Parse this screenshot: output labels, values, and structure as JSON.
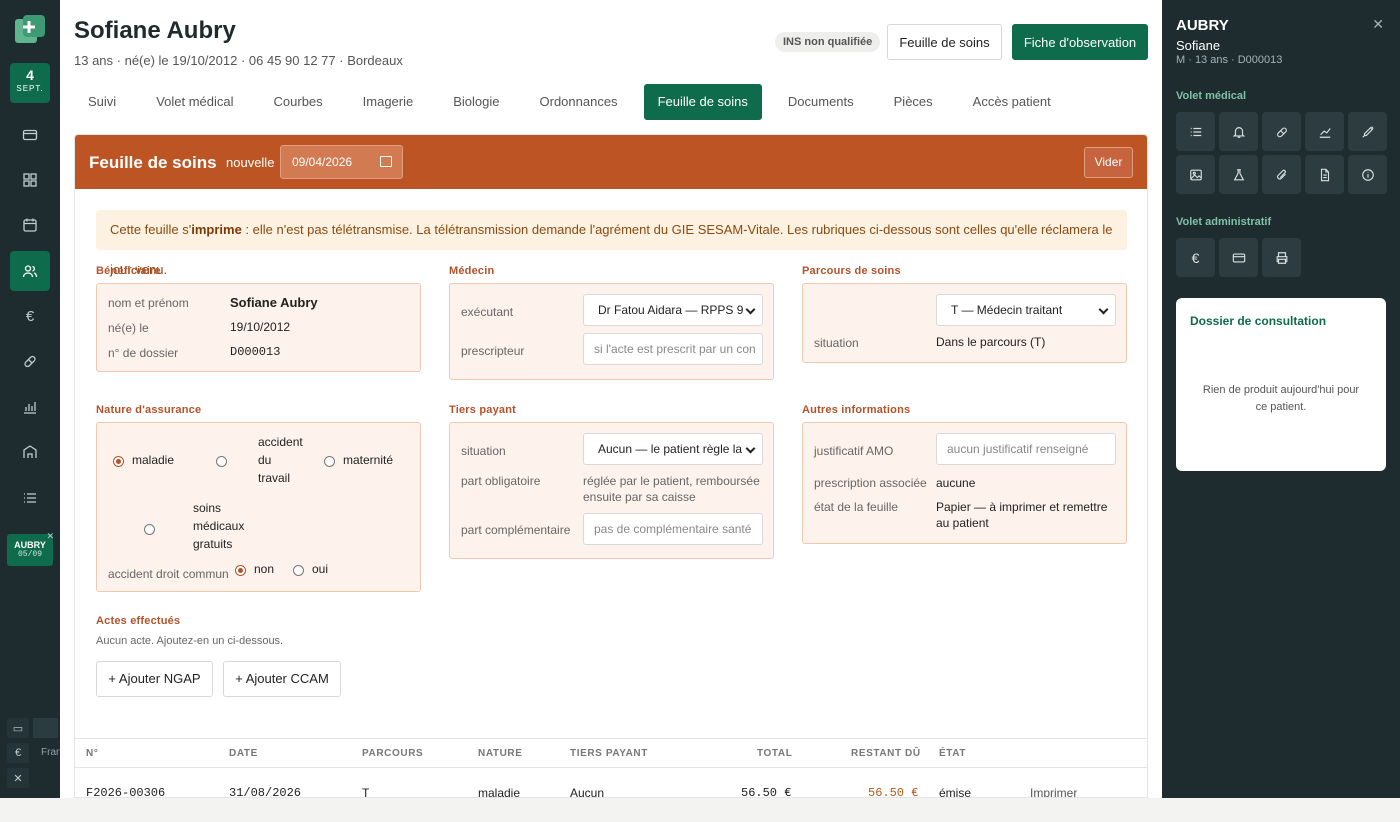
{
  "rail": {
    "date_day": "4",
    "date_month": "SEPT.",
    "chip_name": "AUBRY",
    "chip_date": "05/09",
    "lang_label": "Fran"
  },
  "patient": {
    "name": "Sofiane Aubry",
    "subtitle": "13 ans · né(e) le 19/10/2012 · 06 45 90 12 77 · Bordeaux",
    "ins_badge": "INS non qualifiée"
  },
  "header_buttons": {
    "feuille": "Feuille de soins",
    "fiche": "Fiche d'observation"
  },
  "tabs": [
    {
      "label": "Suivi"
    },
    {
      "label": "Volet médical"
    },
    {
      "label": "Courbes"
    },
    {
      "label": "Imagerie"
    },
    {
      "label": "Biologie"
    },
    {
      "label": "Ordonnances"
    },
    {
      "label": "Feuille de soins"
    },
    {
      "label": "Documents"
    },
    {
      "label": "Pièces"
    },
    {
      "label": "Accès patient"
    }
  ],
  "fs": {
    "title": "Feuille de soins",
    "new_label": "nouvelle",
    "date_value": "09/04/2026",
    "clear_label": "Vider",
    "notice_prefix": "Cette feuille s'",
    "notice_bold": "imprime",
    "notice_suffix": " : elle n'est pas télétransmise. La télétransmission demande l'agrément du GIE SESAM-Vitale. Les rubriques ci-dessous sont celles qu'elle réclamera le jour venu."
  },
  "beneficiaire": {
    "heading": "Bénéficiaire",
    "name_label": "nom et prénom",
    "name_value": "Sofiane Aubry",
    "birth_label": "né(e) le",
    "birth_value": "19/10/2012",
    "file_label": "n° de dossier",
    "file_value": "D000013"
  },
  "medecin": {
    "heading": "Médecin",
    "exec_label": "exécutant",
    "exec_value": "Dr Fatou Aidara — RPPS 9",
    "presc_label": "prescripteur",
    "presc_placeholder": "si l'acte est prescrit par un con"
  },
  "parcours": {
    "heading": "Parcours de soins",
    "select_value": "T — Médecin traitant",
    "situation_label": "situation",
    "situation_value": "Dans le parcours (T)"
  },
  "assurance": {
    "heading": "Nature d'assurance",
    "options": [
      {
        "label": "maladie",
        "checked": true
      },
      {
        "label": "accident du travail",
        "checked": false
      },
      {
        "label": "maternité",
        "checked": false
      },
      {
        "label": "soins médicaux gratuits",
        "checked": false
      }
    ],
    "adc_label": "accident droit commun",
    "adc_no": "non",
    "adc_yes": "oui"
  },
  "tiers": {
    "heading": "Tiers payant",
    "situation_label": "situation",
    "situation_value": "Aucun — le patient règle la",
    "oblig_label": "part obligatoire",
    "oblig_value": "réglée par le patient, remboursée ensuite par sa caisse",
    "compl_label": "part complémentaire",
    "compl_placeholder": "pas de complémentaire santé"
  },
  "autres": {
    "heading": "Autres informations",
    "amo_label": "justificatif AMO",
    "amo_placeholder": "aucun justificatif renseigné",
    "presc_label": "prescription associée",
    "presc_value": "aucune",
    "state_label": "état de la feuille",
    "state_value": "Papier — à imprimer et remettre au patient"
  },
  "actes": {
    "heading": "Actes effectués",
    "empty": "Aucun acte. Ajoutez-en un ci-dessous.",
    "add_ngap": "+ Ajouter NGAP",
    "add_ccam": "+ Ajouter CCAM"
  },
  "table": {
    "headers": [
      "N°",
      "DATE",
      "PARCOURS",
      "NATURE",
      "TIERS PAYANT",
      "TOTAL",
      "RESTANT DÛ",
      "ÉTAT"
    ],
    "rows": [
      {
        "num": "F2026-00306",
        "date": "31/08/2026",
        "parcours": "T",
        "nature": "maladie",
        "tiers": "Aucun",
        "total": "56.50 €",
        "restant": "56.50 €",
        "etat": "émise",
        "action": "Imprimer"
      }
    ]
  },
  "sidebar": {
    "last_name": "AUBRY",
    "first_name": "Sofiane",
    "meta": "M · 13 ans · D000013",
    "volet_medical": "Volet médical",
    "volet_admin": "Volet administratif",
    "card_title": "Dossier de consultation",
    "card_body": "Rien de produit aujourd'hui pour ce patient."
  },
  "colors": {
    "brand_green": "#0e6b4c",
    "header_orange": "#bd5424",
    "dark_panel": "#1e2b2f"
  }
}
